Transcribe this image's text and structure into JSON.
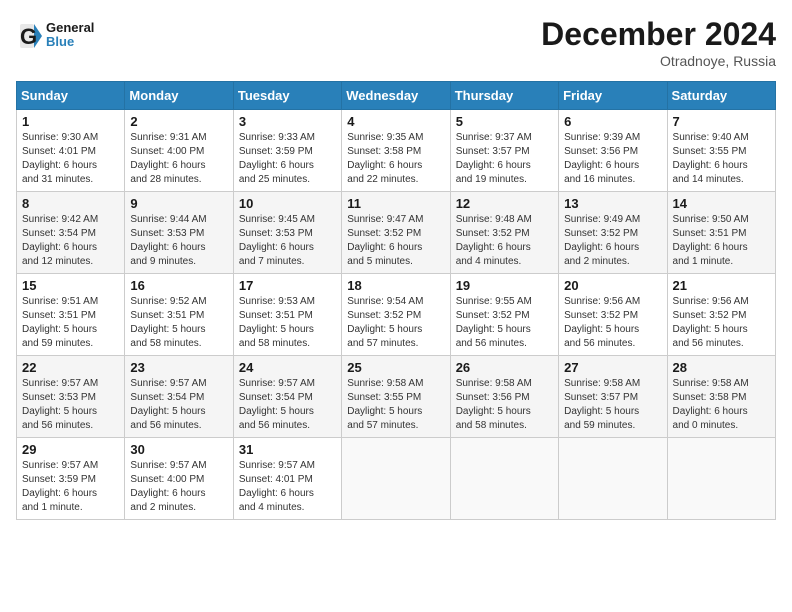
{
  "logo": {
    "line1": "General",
    "line2": "Blue"
  },
  "title": "December 2024",
  "subtitle": "Otradnoye, Russia",
  "days_of_week": [
    "Sunday",
    "Monday",
    "Tuesday",
    "Wednesday",
    "Thursday",
    "Friday",
    "Saturday"
  ],
  "weeks": [
    [
      {
        "day": "1",
        "info": "Sunrise: 9:30 AM\nSunset: 4:01 PM\nDaylight: 6 hours\nand 31 minutes."
      },
      {
        "day": "2",
        "info": "Sunrise: 9:31 AM\nSunset: 4:00 PM\nDaylight: 6 hours\nand 28 minutes."
      },
      {
        "day": "3",
        "info": "Sunrise: 9:33 AM\nSunset: 3:59 PM\nDaylight: 6 hours\nand 25 minutes."
      },
      {
        "day": "4",
        "info": "Sunrise: 9:35 AM\nSunset: 3:58 PM\nDaylight: 6 hours\nand 22 minutes."
      },
      {
        "day": "5",
        "info": "Sunrise: 9:37 AM\nSunset: 3:57 PM\nDaylight: 6 hours\nand 19 minutes."
      },
      {
        "day": "6",
        "info": "Sunrise: 9:39 AM\nSunset: 3:56 PM\nDaylight: 6 hours\nand 16 minutes."
      },
      {
        "day": "7",
        "info": "Sunrise: 9:40 AM\nSunset: 3:55 PM\nDaylight: 6 hours\nand 14 minutes."
      }
    ],
    [
      {
        "day": "8",
        "info": "Sunrise: 9:42 AM\nSunset: 3:54 PM\nDaylight: 6 hours\nand 12 minutes."
      },
      {
        "day": "9",
        "info": "Sunrise: 9:44 AM\nSunset: 3:53 PM\nDaylight: 6 hours\nand 9 minutes."
      },
      {
        "day": "10",
        "info": "Sunrise: 9:45 AM\nSunset: 3:53 PM\nDaylight: 6 hours\nand 7 minutes."
      },
      {
        "day": "11",
        "info": "Sunrise: 9:47 AM\nSunset: 3:52 PM\nDaylight: 6 hours\nand 5 minutes."
      },
      {
        "day": "12",
        "info": "Sunrise: 9:48 AM\nSunset: 3:52 PM\nDaylight: 6 hours\nand 4 minutes."
      },
      {
        "day": "13",
        "info": "Sunrise: 9:49 AM\nSunset: 3:52 PM\nDaylight: 6 hours\nand 2 minutes."
      },
      {
        "day": "14",
        "info": "Sunrise: 9:50 AM\nSunset: 3:51 PM\nDaylight: 6 hours\nand 1 minute."
      }
    ],
    [
      {
        "day": "15",
        "info": "Sunrise: 9:51 AM\nSunset: 3:51 PM\nDaylight: 5 hours\nand 59 minutes."
      },
      {
        "day": "16",
        "info": "Sunrise: 9:52 AM\nSunset: 3:51 PM\nDaylight: 5 hours\nand 58 minutes."
      },
      {
        "day": "17",
        "info": "Sunrise: 9:53 AM\nSunset: 3:51 PM\nDaylight: 5 hours\nand 58 minutes."
      },
      {
        "day": "18",
        "info": "Sunrise: 9:54 AM\nSunset: 3:52 PM\nDaylight: 5 hours\nand 57 minutes."
      },
      {
        "day": "19",
        "info": "Sunrise: 9:55 AM\nSunset: 3:52 PM\nDaylight: 5 hours\nand 56 minutes."
      },
      {
        "day": "20",
        "info": "Sunrise: 9:56 AM\nSunset: 3:52 PM\nDaylight: 5 hours\nand 56 minutes."
      },
      {
        "day": "21",
        "info": "Sunrise: 9:56 AM\nSunset: 3:52 PM\nDaylight: 5 hours\nand 56 minutes."
      }
    ],
    [
      {
        "day": "22",
        "info": "Sunrise: 9:57 AM\nSunset: 3:53 PM\nDaylight: 5 hours\nand 56 minutes."
      },
      {
        "day": "23",
        "info": "Sunrise: 9:57 AM\nSunset: 3:54 PM\nDaylight: 5 hours\nand 56 minutes."
      },
      {
        "day": "24",
        "info": "Sunrise: 9:57 AM\nSunset: 3:54 PM\nDaylight: 5 hours\nand 56 minutes."
      },
      {
        "day": "25",
        "info": "Sunrise: 9:58 AM\nSunset: 3:55 PM\nDaylight: 5 hours\nand 57 minutes."
      },
      {
        "day": "26",
        "info": "Sunrise: 9:58 AM\nSunset: 3:56 PM\nDaylight: 5 hours\nand 58 minutes."
      },
      {
        "day": "27",
        "info": "Sunrise: 9:58 AM\nSunset: 3:57 PM\nDaylight: 5 hours\nand 59 minutes."
      },
      {
        "day": "28",
        "info": "Sunrise: 9:58 AM\nSunset: 3:58 PM\nDaylight: 6 hours\nand 0 minutes."
      }
    ],
    [
      {
        "day": "29",
        "info": "Sunrise: 9:57 AM\nSunset: 3:59 PM\nDaylight: 6 hours\nand 1 minute."
      },
      {
        "day": "30",
        "info": "Sunrise: 9:57 AM\nSunset: 4:00 PM\nDaylight: 6 hours\nand 2 minutes."
      },
      {
        "day": "31",
        "info": "Sunrise: 9:57 AM\nSunset: 4:01 PM\nDaylight: 6 hours\nand 4 minutes."
      },
      null,
      null,
      null,
      null
    ]
  ]
}
